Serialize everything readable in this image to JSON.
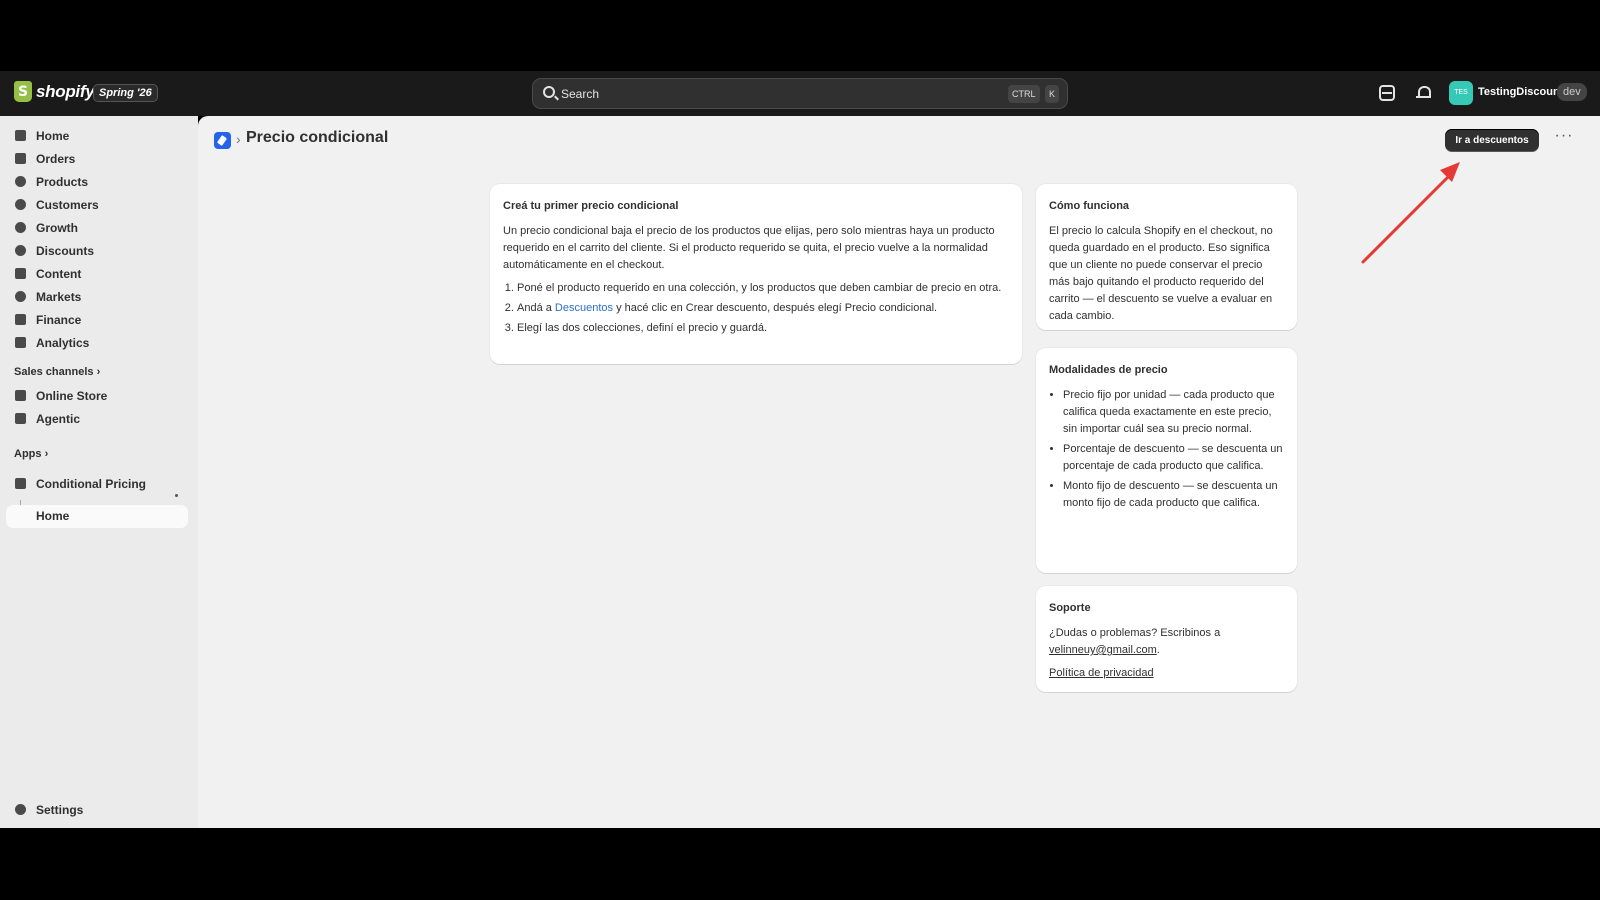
{
  "topbar": {
    "brand": "shopify",
    "season_badge": "Spring '26",
    "search_placeholder": "Search",
    "search_kbd_1": "CTRL",
    "search_kbd_2": "K",
    "avatar_initials": "TES",
    "store_name": "TestingDiscount",
    "env_badge": "dev"
  },
  "sidebar": {
    "items": [
      {
        "label": "Home",
        "icon": "home-icon"
      },
      {
        "label": "Orders",
        "icon": "orders-icon"
      },
      {
        "label": "Products",
        "icon": "tag-icon"
      },
      {
        "label": "Customers",
        "icon": "person-icon"
      },
      {
        "label": "Growth",
        "icon": "growth-icon"
      },
      {
        "label": "Discounts",
        "icon": "discount-icon"
      },
      {
        "label": "Content",
        "icon": "content-icon"
      },
      {
        "label": "Markets",
        "icon": "globe-icon"
      },
      {
        "label": "Finance",
        "icon": "bank-icon"
      },
      {
        "label": "Analytics",
        "icon": "chart-icon"
      }
    ],
    "sales_channels_label": "Sales channels",
    "sales_channels": [
      {
        "label": "Online Store",
        "icon": "store-icon"
      },
      {
        "label": "Agentic",
        "icon": "agent-icon"
      }
    ],
    "apps_label": "Apps",
    "app_name": "Conditional Pricing",
    "app_sub_item": "Home",
    "settings_label": "Settings"
  },
  "page": {
    "title": "Precio condicional",
    "primary_action": "Ir a descuentos",
    "more_label": "···"
  },
  "main_card": {
    "title": "Creá tu primer precio condicional",
    "intro": "Un precio condicional baja el precio de los productos que elijas, pero solo mientras haya un producto requerido en el carrito del cliente. Si el producto requerido se quita, el precio vuelve a la normalidad automáticamente en el checkout.",
    "step1": "Poné el producto requerido en una colección, y los productos que deben cambiar de precio en otra.",
    "step2_pre": "Andá a ",
    "step2_link": "Descuentos",
    "step2_post": " y hacé clic en Crear descuento, después elegí Precio condicional.",
    "step3": "Elegí las dos colecciones, definí el precio y guardá."
  },
  "how_card": {
    "title": "Cómo funciona",
    "body": "El precio lo calcula Shopify en el checkout, no queda guardado en el producto. Eso significa que un cliente no puede conservar el precio más bajo quitando el producto requerido del carrito — el descuento se vuelve a evaluar en cada cambio."
  },
  "modes_card": {
    "title": "Modalidades de precio",
    "items": [
      "Precio fijo por unidad — cada producto que califica queda exactamente en este precio, sin importar cuál sea su precio normal.",
      "Porcentaje de descuento — se descuenta un porcentaje de cada producto que califica.",
      "Monto fijo de descuento — se descuenta un monto fijo de cada producto que califica."
    ]
  },
  "support_card": {
    "title": "Soporte",
    "body": "¿Dudas o problemas? Escribinos a ",
    "email": "velinneuy@gmail.com",
    "body_end": ".",
    "privacy_link": "Política de privacidad"
  },
  "colors": {
    "accent_arrow": "#e53935",
    "link": "#2c6ecb",
    "avatar": "#36c9b5"
  }
}
